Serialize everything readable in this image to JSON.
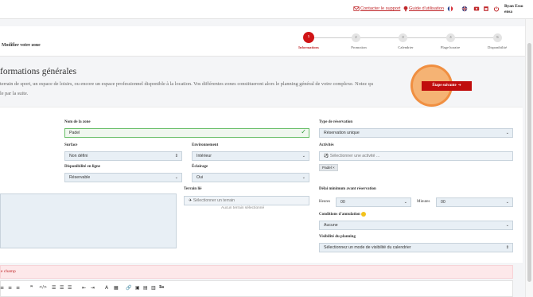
{
  "header": {
    "contact_label": "Contacter le support",
    "guide_label": "Guide d'utilisation",
    "user_name_line1": "Ryan Esso",
    "user_name_line2": "ensa"
  },
  "stepper": {
    "zone_title": "Modifier votre zone",
    "steps": [
      {
        "num": "1",
        "label": "Informations",
        "active": true
      },
      {
        "num": "2",
        "label": "Promotion"
      },
      {
        "num": "3",
        "label": "Calendrier"
      },
      {
        "num": "4",
        "label": "Plage horaire"
      },
      {
        "num": "5",
        "label": "Disponibilité"
      }
    ]
  },
  "section": {
    "title": "formations générales",
    "desc_line1": "terrain de sport, un espace de loisirs, ou encore un espace professionnel disponible à la location. Vos différentes zones constitueront alors le planning général de votre complexe. Notez qu",
    "desc_line2": "le par la suite.",
    "next_label": "Étape suivante",
    "next_arrow": "➔"
  },
  "form": {
    "zone_name_label": "Nom de la zone",
    "zone_name_value": "Padel",
    "surface_label": "Surface",
    "surface_value": "Non défini",
    "environment_label": "Environnement",
    "environment_value": "Intérieur",
    "online_label": "Disponibilité en ligne",
    "online_value": "Réservable",
    "lighting_label": "Éclairage",
    "lighting_value": "Oui",
    "linked_field_label": "Terrain lié",
    "linked_field_placeholder": "Sélectionner un terrain",
    "linked_field_note": "Aucun terrain sélectionné",
    "reservation_type_label": "Type de réservation",
    "reservation_type_value": "Réservation unique",
    "activities_label": "Activités",
    "activities_placeholder": "Sélectionner une activité ...",
    "activity_tag": "Padel",
    "activity_tag_remove": "×",
    "min_delay_label": "Délai minimum avant réservation",
    "hours_label": "Heures",
    "hours_value": "00",
    "minutes_label": "Minutes",
    "minutes_value": "00",
    "cancel_label": "Conditions d'annulation",
    "cancel_value": "Aucune",
    "visibility_label": "Visibilité du planning",
    "visibility_placeholder": "Sélectionnez un mode de visibilité du calendrier"
  },
  "alert": {
    "text": "e champ"
  },
  "toolbar": {
    "buttons": [
      "≡",
      "≡",
      "≡",
      "❞",
      "</>",
      "☰",
      "☰",
      "☰",
      "⇤",
      "⇥",
      "A",
      "▦",
      "🔗",
      "▣",
      "▤",
      "▥",
      "Tx"
    ]
  },
  "colors": {
    "accent": "#c00d0d",
    "halo": "#f3a054",
    "valid": "#2e9b3b"
  }
}
